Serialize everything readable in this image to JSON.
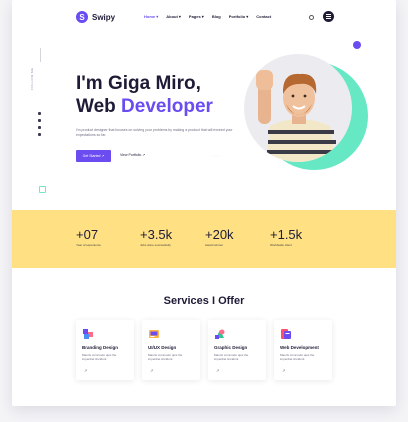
{
  "brand": {
    "name": "Swipy",
    "mark": "S"
  },
  "nav": {
    "items": [
      {
        "label": "Home ▾",
        "active": true
      },
      {
        "label": "About ▾",
        "active": false
      },
      {
        "label": "Pages ▾",
        "active": false
      },
      {
        "label": "Blog",
        "active": false
      },
      {
        "label": "Portfolio ▾",
        "active": false
      },
      {
        "label": "Contact",
        "active": false
      }
    ]
  },
  "rail": {
    "label": "FOLLOW ME"
  },
  "hero": {
    "title_line1": "I'm Giga Miro,",
    "title_line2_plain": "Web ",
    "title_line2_accent": "Developer",
    "description": "I'm product designer that focuses on solving your problems by making a product that will exceed your expectations so far.",
    "primary_button": "Get Started ↗",
    "secondary_link": "View Portfolio ↗"
  },
  "stats": [
    {
      "value": "+07",
      "label": "Year of experience"
    },
    {
      "value": "+3.5k",
      "label": "Jobs done successfully"
    },
    {
      "value": "+20k",
      "label": "Award winner"
    },
    {
      "value": "+1.5k",
      "label": "Worldwide client"
    }
  ],
  "services": {
    "title": "Services I Offer",
    "cards": [
      {
        "title": "Branding Design",
        "desc": "Mauris commodo quis the imperdiet tincidunt.",
        "icon": "branding-icon"
      },
      {
        "title": "UI/UX Design",
        "desc": "Mauris commodo quis the imperdiet tincidunt.",
        "icon": "uiux-icon"
      },
      {
        "title": "Graphic Design",
        "desc": "Mauris commodo quis the imperdiet tincidunt.",
        "icon": "graphic-icon"
      },
      {
        "title": "Web Development",
        "desc": "Mauris commodo quis the imperdiet tincidunt.",
        "icon": "webdev-icon"
      }
    ]
  },
  "colors": {
    "accent": "#6a4cf0",
    "mint": "#66e8c5",
    "stats_band": "#ffe083",
    "ink": "#1d1b36"
  }
}
